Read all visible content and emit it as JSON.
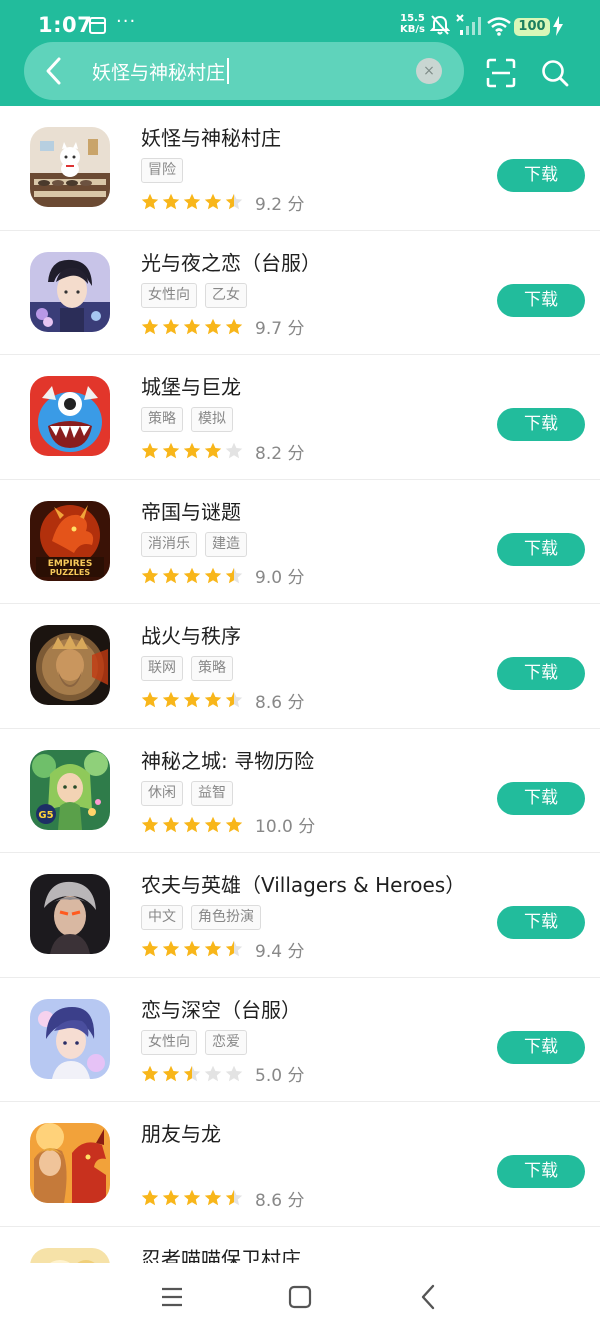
{
  "status_bar": {
    "time": "1:07",
    "more": "···",
    "speed_value": "15.5",
    "speed_unit": "KB/s",
    "battery": "100"
  },
  "search": {
    "query": "妖怪与神秘村庄",
    "clear_label": "×"
  },
  "colors": {
    "accent": "#22bc9c",
    "star_filled": "#f8b61a",
    "star_empty": "#e3e3e3"
  },
  "download_label": "下载",
  "score_unit": "分",
  "apps": [
    {
      "name": "妖怪与神秘村庄",
      "tags": [
        "冒险"
      ],
      "rating": 4.5,
      "score": "9.2 分",
      "icon": "maneki-neko-shelf-icon"
    },
    {
      "name": "光与夜之恋（台服）",
      "tags": [
        "女性向",
        "乙女"
      ],
      "rating": 5,
      "score": "9.7 分",
      "icon": "anime-man-portrait-icon"
    },
    {
      "name": "城堡与巨龙",
      "tags": [
        "策略",
        "模拟"
      ],
      "rating": 4,
      "score": "8.2 分",
      "icon": "blue-monster-icon"
    },
    {
      "name": "帝国与谜题",
      "tags": [
        "消消乐",
        "建造"
      ],
      "rating": 4.5,
      "score": "9.0 分",
      "icon": "red-dragon-icon",
      "icon_text": "EMPIRES PUZZLES"
    },
    {
      "name": "战火与秩序",
      "tags": [
        "联网",
        "策略"
      ],
      "rating": 4.5,
      "score": "8.6 分",
      "icon": "bronze-king-coin-icon"
    },
    {
      "name": "神秘之城: 寻物历险",
      "tags": [
        "休闲",
        "益智"
      ],
      "rating": 5,
      "score": "10.0 分",
      "icon": "forest-maiden-icon",
      "icon_text": "G5"
    },
    {
      "name": "农夫与英雄（Villagers & Heroes）",
      "tags": [
        "中文",
        "角色扮演"
      ],
      "rating": 4.5,
      "score": "9.4 分",
      "icon": "dark-warrior-icon"
    },
    {
      "name": "恋与深空（台服）",
      "tags": [
        "女性向",
        "恋爱"
      ],
      "rating": 2.5,
      "score": "5.0 分",
      "icon": "anime-boy-icon"
    },
    {
      "name": "朋友与龙",
      "tags": [],
      "rating": 4.5,
      "score": "8.6 分",
      "icon": "knight-and-dragon-icon"
    },
    {
      "name": "忍者喵喵保卫村庄",
      "tags": [],
      "rating": 0,
      "score": "",
      "icon": "ninja-cat-icon"
    }
  ],
  "nav": {
    "menu_icon": "menu-icon",
    "home_icon": "home-square-icon",
    "back_icon": "back-triangle-icon"
  }
}
